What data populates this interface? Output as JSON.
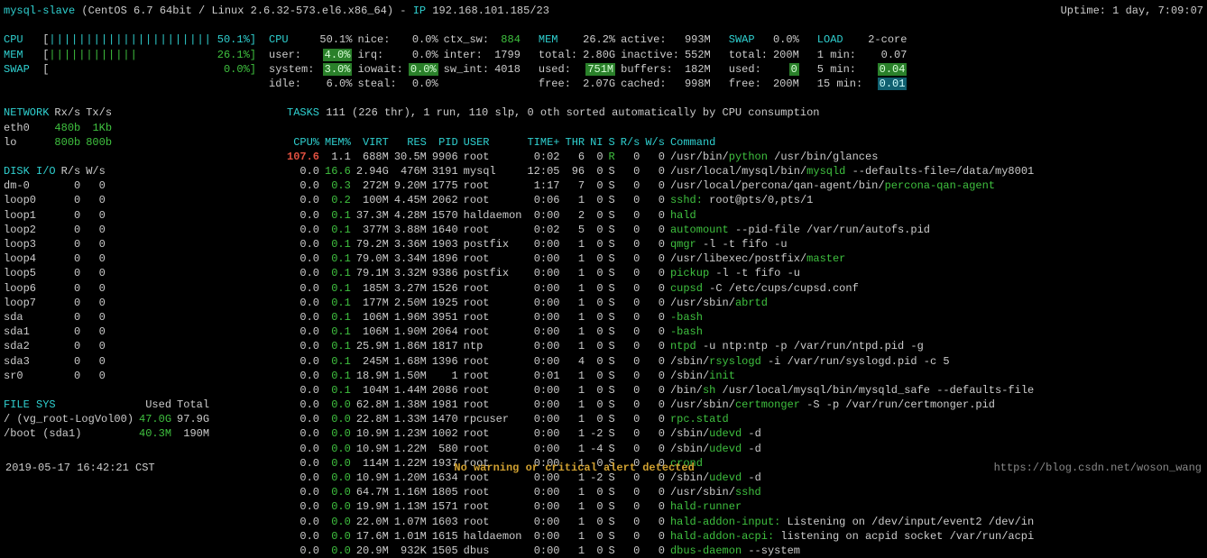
{
  "header": {
    "hostname": "mysql-slave",
    "os": "(CentOS 6.7 64bit / Linux 2.6.32-573.el6.x86_64)",
    "ip_label": "IP",
    "ip": "192.168.101.185/23",
    "uptime": "Uptime: 1 day, 7:09:07"
  },
  "bars": {
    "cpu_label": "CPU",
    "cpu_fill": "||||||||||||||||||||||",
    "cpu_val": "50.1%",
    "mem_label": "MEM",
    "mem_fill": "||||||||||||",
    "mem_val": "26.1%",
    "swap_label": "SWAP",
    "swap_fill": "",
    "swap_val": "0.0%"
  },
  "cpu_block": {
    "title": "CPU",
    "total": "50.1%",
    "user_l": "user:",
    "user_v": "4.0%",
    "system_l": "system:",
    "system_v": "3.0%",
    "idle_l": "idle:",
    "idle_v": "6.0%",
    "nice_l": "nice:",
    "nice_v": "0.0%",
    "irq_l": "irq:",
    "irq_v": "0.0%",
    "iowait_l": "iowait:",
    "iowait_v": "0.0%",
    "steal_l": "steal:",
    "steal_v": "0.0%",
    "ctx_l": "ctx_sw:",
    "ctx_v": "884",
    "inter_l": "inter:",
    "inter_v": "1799",
    "swint_l": "sw_int:",
    "swint_v": "4018"
  },
  "mem_block": {
    "title": "MEM",
    "total_pct": "26.2%",
    "total_l": "total:",
    "total_v": "2.80G",
    "used_l": "used:",
    "used_v": "751M",
    "free_l": "free:",
    "free_v": "2.07G",
    "active_l": "active:",
    "active_v": "993M",
    "inactive_l": "inactive:",
    "inactive_v": "552M",
    "buffers_l": "buffers:",
    "buffers_v": "182M",
    "cached_l": "cached:",
    "cached_v": "998M"
  },
  "swap_block": {
    "title": "SWAP",
    "pct": "0.0%",
    "total_l": "total:",
    "total_v": "200M",
    "used_l": "used:",
    "used_v": "0",
    "free_l": "free:",
    "free_v": "200M"
  },
  "load_block": {
    "title": "LOAD",
    "core": "2-core",
    "m1_l": "1 min:",
    "m1_v": "0.07",
    "m5_l": "5 min:",
    "m5_v": "0.04",
    "m15_l": "15 min:",
    "m15_v": "0.01"
  },
  "tasks_line": "TASKS 111 (226 thr), 1 run, 110 slp, 0 oth sorted automatically by CPU consumption",
  "network": {
    "title": "NETWORK",
    "hrx": "Rx/s",
    "htx": "Tx/s",
    "rows": [
      {
        "if": "eth0",
        "rx": "480b",
        "tx": "1Kb"
      },
      {
        "if": "lo",
        "rx": "800b",
        "tx": "800b"
      }
    ]
  },
  "disk": {
    "title": "DISK I/O",
    "hr": "R/s",
    "hw": "W/s",
    "rows": [
      {
        "d": "dm-0",
        "r": "0",
        "w": "0"
      },
      {
        "d": "loop0",
        "r": "0",
        "w": "0"
      },
      {
        "d": "loop1",
        "r": "0",
        "w": "0"
      },
      {
        "d": "loop2",
        "r": "0",
        "w": "0"
      },
      {
        "d": "loop3",
        "r": "0",
        "w": "0"
      },
      {
        "d": "loop4",
        "r": "0",
        "w": "0"
      },
      {
        "d": "loop5",
        "r": "0",
        "w": "0"
      },
      {
        "d": "loop6",
        "r": "0",
        "w": "0"
      },
      {
        "d": "loop7",
        "r": "0",
        "w": "0"
      },
      {
        "d": "sda",
        "r": "0",
        "w": "0"
      },
      {
        "d": "sda1",
        "r": "0",
        "w": "0"
      },
      {
        "d": "sda2",
        "r": "0",
        "w": "0"
      },
      {
        "d": "sda3",
        "r": "0",
        "w": "0"
      },
      {
        "d": "sr0",
        "r": "0",
        "w": "0"
      }
    ]
  },
  "fs": {
    "title": "FILE SYS",
    "hu": "Used",
    "ht": "Total",
    "rows": [
      {
        "d": "/ (vg_root-LogVol00)",
        "u": "47.0G",
        "t": "97.9G"
      },
      {
        "d": "/boot (sda1)",
        "u": "40.3M",
        "t": "190M"
      }
    ]
  },
  "proc_headers": [
    "CPU%",
    "MEM%",
    "VIRT",
    "RES",
    "PID",
    "USER",
    "TIME+",
    "THR",
    "NI",
    "S",
    "R/s",
    "W/s",
    "Command"
  ],
  "processes": [
    {
      "cpu": "107.6",
      "cpu_cls": "redb",
      "mem": "1.1",
      "virt": "688M",
      "res": "30.5M",
      "pid": "9906",
      "user": "root",
      "time": "0:02",
      "thr": "6",
      "ni": "0",
      "s": "R",
      "sc": "green",
      "rs": "0",
      "ws": "0",
      "cmd": [
        {
          "t": "/usr/bin/",
          "c": ""
        },
        {
          "t": "python",
          "c": "green"
        },
        {
          "t": " /usr/bin/glances",
          "c": ""
        }
      ]
    },
    {
      "cpu": "0.0",
      "mem": "16.6",
      "mem_cls": "green",
      "virt": "2.94G",
      "res": "476M",
      "pid": "3191",
      "user": "mysql",
      "time": "12:05",
      "thr": "96",
      "ni": "0",
      "s": "S",
      "rs": "0",
      "ws": "0",
      "cmd": [
        {
          "t": "/usr/local/mysql/bin/",
          "c": ""
        },
        {
          "t": "mysqld",
          "c": "green"
        },
        {
          "t": " --defaults-file=/data/my8001",
          "c": ""
        }
      ]
    },
    {
      "cpu": "0.0",
      "mem": "0.3",
      "mem_cls": "green",
      "virt": "272M",
      "res": "9.20M",
      "pid": "1775",
      "user": "root",
      "time": "1:17",
      "thr": "7",
      "ni": "0",
      "s": "S",
      "rs": "0",
      "ws": "0",
      "cmd": [
        {
          "t": "/usr/local/percona/qan-agent/bin/",
          "c": ""
        },
        {
          "t": "percona-qan-agent",
          "c": "green"
        }
      ]
    },
    {
      "cpu": "0.0",
      "mem": "0.2",
      "mem_cls": "green",
      "virt": "100M",
      "res": "4.45M",
      "pid": "2062",
      "user": "root",
      "time": "0:06",
      "thr": "1",
      "ni": "0",
      "s": "S",
      "rs": "0",
      "ws": "0",
      "cmd": [
        {
          "t": "sshd:",
          "c": "green"
        },
        {
          "t": " root@pts/0,pts/1",
          "c": ""
        }
      ]
    },
    {
      "cpu": "0.0",
      "mem": "0.1",
      "mem_cls": "green",
      "virt": "37.3M",
      "res": "4.28M",
      "pid": "1570",
      "user": "haldaemon",
      "time": "0:00",
      "thr": "2",
      "ni": "0",
      "s": "S",
      "rs": "0",
      "ws": "0",
      "cmd": [
        {
          "t": "hald",
          "c": "green"
        }
      ]
    },
    {
      "cpu": "0.0",
      "mem": "0.1",
      "mem_cls": "green",
      "virt": "377M",
      "res": "3.88M",
      "pid": "1640",
      "user": "root",
      "time": "0:02",
      "thr": "5",
      "ni": "0",
      "s": "S",
      "rs": "0",
      "ws": "0",
      "cmd": [
        {
          "t": "automount",
          "c": "green"
        },
        {
          "t": " --pid-file /var/run/autofs.pid",
          "c": ""
        }
      ]
    },
    {
      "cpu": "0.0",
      "mem": "0.1",
      "mem_cls": "green",
      "virt": "79.2M",
      "res": "3.36M",
      "pid": "1903",
      "user": "postfix",
      "time": "0:00",
      "thr": "1",
      "ni": "0",
      "s": "S",
      "rs": "0",
      "ws": "0",
      "cmd": [
        {
          "t": "qmgr",
          "c": "green"
        },
        {
          "t": " -l -t fifo -u",
          "c": ""
        }
      ]
    },
    {
      "cpu": "0.0",
      "mem": "0.1",
      "mem_cls": "green",
      "virt": "79.0M",
      "res": "3.34M",
      "pid": "1896",
      "user": "root",
      "time": "0:00",
      "thr": "1",
      "ni": "0",
      "s": "S",
      "rs": "0",
      "ws": "0",
      "cmd": [
        {
          "t": "/usr/libexec/postfix/",
          "c": ""
        },
        {
          "t": "master",
          "c": "green"
        }
      ]
    },
    {
      "cpu": "0.0",
      "mem": "0.1",
      "mem_cls": "green",
      "virt": "79.1M",
      "res": "3.32M",
      "pid": "9386",
      "user": "postfix",
      "time": "0:00",
      "thr": "1",
      "ni": "0",
      "s": "S",
      "rs": "0",
      "ws": "0",
      "cmd": [
        {
          "t": "pickup",
          "c": "green"
        },
        {
          "t": " -l -t fifo -u",
          "c": ""
        }
      ]
    },
    {
      "cpu": "0.0",
      "mem": "0.1",
      "mem_cls": "green",
      "virt": "185M",
      "res": "3.27M",
      "pid": "1526",
      "user": "root",
      "time": "0:00",
      "thr": "1",
      "ni": "0",
      "s": "S",
      "rs": "0",
      "ws": "0",
      "cmd": [
        {
          "t": "cupsd",
          "c": "green"
        },
        {
          "t": " -C /etc/cups/cupsd.conf",
          "c": ""
        }
      ]
    },
    {
      "cpu": "0.0",
      "mem": "0.1",
      "mem_cls": "green",
      "virt": "177M",
      "res": "2.50M",
      "pid": "1925",
      "user": "root",
      "time": "0:00",
      "thr": "1",
      "ni": "0",
      "s": "S",
      "rs": "0",
      "ws": "0",
      "cmd": [
        {
          "t": "/usr/sbin/",
          "c": ""
        },
        {
          "t": "abrtd",
          "c": "green"
        }
      ]
    },
    {
      "cpu": "0.0",
      "mem": "0.1",
      "mem_cls": "green",
      "virt": "106M",
      "res": "1.96M",
      "pid": "3951",
      "user": "root",
      "time": "0:00",
      "thr": "1",
      "ni": "0",
      "s": "S",
      "rs": "0",
      "ws": "0",
      "cmd": [
        {
          "t": "-bash",
          "c": "green"
        }
      ]
    },
    {
      "cpu": "0.0",
      "mem": "0.1",
      "mem_cls": "green",
      "virt": "106M",
      "res": "1.90M",
      "pid": "2064",
      "user": "root",
      "time": "0:00",
      "thr": "1",
      "ni": "0",
      "s": "S",
      "rs": "0",
      "ws": "0",
      "cmd": [
        {
          "t": "-bash",
          "c": "green"
        }
      ]
    },
    {
      "cpu": "0.0",
      "mem": "0.1",
      "mem_cls": "green",
      "virt": "25.9M",
      "res": "1.86M",
      "pid": "1817",
      "user": "ntp",
      "time": "0:00",
      "thr": "1",
      "ni": "0",
      "s": "S",
      "rs": "0",
      "ws": "0",
      "cmd": [
        {
          "t": "ntpd",
          "c": "green"
        },
        {
          "t": " -u ntp:ntp -p /var/run/ntpd.pid -g",
          "c": ""
        }
      ]
    },
    {
      "cpu": "0.0",
      "mem": "0.1",
      "mem_cls": "green",
      "virt": "245M",
      "res": "1.68M",
      "pid": "1396",
      "user": "root",
      "time": "0:00",
      "thr": "4",
      "ni": "0",
      "s": "S",
      "rs": "0",
      "ws": "0",
      "cmd": [
        {
          "t": "/sbin/",
          "c": ""
        },
        {
          "t": "rsyslogd",
          "c": "green"
        },
        {
          "t": " -i /var/run/syslogd.pid -c 5",
          "c": ""
        }
      ]
    },
    {
      "cpu": "0.0",
      "mem": "0.1",
      "mem_cls": "green",
      "virt": "18.9M",
      "res": "1.50M",
      "pid": "1",
      "user": "root",
      "time": "0:01",
      "thr": "1",
      "ni": "0",
      "s": "S",
      "rs": "0",
      "ws": "0",
      "cmd": [
        {
          "t": "/sbin/",
          "c": ""
        },
        {
          "t": "init",
          "c": "green"
        }
      ]
    },
    {
      "cpu": "0.0",
      "mem": "0.1",
      "mem_cls": "green",
      "virt": "104M",
      "res": "1.44M",
      "pid": "2086",
      "user": "root",
      "time": "0:00",
      "thr": "1",
      "ni": "0",
      "s": "S",
      "rs": "0",
      "ws": "0",
      "cmd": [
        {
          "t": "/bin/",
          "c": ""
        },
        {
          "t": "sh",
          "c": "green"
        },
        {
          "t": " /usr/local/mysql/bin/mysqld_safe --defaults-file",
          "c": ""
        }
      ]
    },
    {
      "cpu": "0.0",
      "mem": "0.0",
      "mem_cls": "green",
      "virt": "62.8M",
      "res": "1.38M",
      "pid": "1981",
      "user": "root",
      "time": "0:00",
      "thr": "1",
      "ni": "0",
      "s": "S",
      "rs": "0",
      "ws": "0",
      "cmd": [
        {
          "t": "/usr/sbin/",
          "c": ""
        },
        {
          "t": "certmonger",
          "c": "green"
        },
        {
          "t": " -S -p /var/run/certmonger.pid",
          "c": ""
        }
      ]
    },
    {
      "cpu": "0.0",
      "mem": "0.0",
      "mem_cls": "green",
      "virt": "22.8M",
      "res": "1.33M",
      "pid": "1470",
      "user": "rpcuser",
      "time": "0:00",
      "thr": "1",
      "ni": "0",
      "s": "S",
      "rs": "0",
      "ws": "0",
      "cmd": [
        {
          "t": "rpc.statd",
          "c": "green"
        }
      ]
    },
    {
      "cpu": "0.0",
      "mem": "0.0",
      "mem_cls": "green",
      "virt": "10.9M",
      "res": "1.23M",
      "pid": "1002",
      "user": "root",
      "time": "0:00",
      "thr": "1",
      "ni": "-2",
      "s": "S",
      "rs": "0",
      "ws": "0",
      "cmd": [
        {
          "t": "/sbin/",
          "c": ""
        },
        {
          "t": "udevd",
          "c": "green"
        },
        {
          "t": " -d",
          "c": ""
        }
      ]
    },
    {
      "cpu": "0.0",
      "mem": "0.0",
      "mem_cls": "green",
      "virt": "10.9M",
      "res": "1.22M",
      "pid": "580",
      "user": "root",
      "time": "0:00",
      "thr": "1",
      "ni": "-4",
      "s": "S",
      "rs": "0",
      "ws": "0",
      "cmd": [
        {
          "t": "/sbin/",
          "c": ""
        },
        {
          "t": "udevd",
          "c": "green"
        },
        {
          "t": " -d",
          "c": ""
        }
      ]
    },
    {
      "cpu": "0.0",
      "mem": "0.0",
      "mem_cls": "green",
      "virt": "114M",
      "res": "1.22M",
      "pid": "1937",
      "user": "root",
      "time": "0:00",
      "thr": "1",
      "ni": "0",
      "s": "S",
      "rs": "0",
      "ws": "0",
      "cmd": [
        {
          "t": "crond",
          "c": "green"
        }
      ]
    },
    {
      "cpu": "0.0",
      "mem": "0.0",
      "mem_cls": "green",
      "virt": "10.9M",
      "res": "1.20M",
      "pid": "1634",
      "user": "root",
      "time": "0:00",
      "thr": "1",
      "ni": "-2",
      "s": "S",
      "rs": "0",
      "ws": "0",
      "cmd": [
        {
          "t": "/sbin/",
          "c": ""
        },
        {
          "t": "udevd",
          "c": "green"
        },
        {
          "t": " -d",
          "c": ""
        }
      ]
    },
    {
      "cpu": "0.0",
      "mem": "0.0",
      "mem_cls": "green",
      "virt": "64.7M",
      "res": "1.16M",
      "pid": "1805",
      "user": "root",
      "time": "0:00",
      "thr": "1",
      "ni": "0",
      "s": "S",
      "rs": "0",
      "ws": "0",
      "cmd": [
        {
          "t": "/usr/sbin/",
          "c": ""
        },
        {
          "t": "sshd",
          "c": "green"
        }
      ]
    },
    {
      "cpu": "0.0",
      "mem": "0.0",
      "mem_cls": "green",
      "virt": "19.9M",
      "res": "1.13M",
      "pid": "1571",
      "user": "root",
      "time": "0:00",
      "thr": "1",
      "ni": "0",
      "s": "S",
      "rs": "0",
      "ws": "0",
      "cmd": [
        {
          "t": "hald-runner",
          "c": "green"
        }
      ]
    },
    {
      "cpu": "0.0",
      "mem": "0.0",
      "mem_cls": "green",
      "virt": "22.0M",
      "res": "1.07M",
      "pid": "1603",
      "user": "root",
      "time": "0:00",
      "thr": "1",
      "ni": "0",
      "s": "S",
      "rs": "0",
      "ws": "0",
      "cmd": [
        {
          "t": "hald-addon-input:",
          "c": "green"
        },
        {
          "t": " Listening on /dev/input/event2 /dev/in",
          "c": ""
        }
      ]
    },
    {
      "cpu": "0.0",
      "mem": "0.0",
      "mem_cls": "green",
      "virt": "17.6M",
      "res": "1.01M",
      "pid": "1615",
      "user": "haldaemon",
      "time": "0:00",
      "thr": "1",
      "ni": "0",
      "s": "S",
      "rs": "0",
      "ws": "0",
      "cmd": [
        {
          "t": "hald-addon-acpi:",
          "c": "green"
        },
        {
          "t": " listening on acpid socket /var/run/acpi",
          "c": ""
        }
      ]
    },
    {
      "cpu": "0.0",
      "mem": "0.0",
      "mem_cls": "green",
      "virt": "20.9M",
      "res": "932K",
      "pid": "1505",
      "user": "dbus",
      "time": "0:00",
      "thr": "1",
      "ni": "0",
      "s": "S",
      "rs": "0",
      "ws": "0",
      "cmd": [
        {
          "t": "dbus-daemon",
          "c": "green"
        },
        {
          "t": " --system",
          "c": ""
        }
      ]
    }
  ],
  "footer": {
    "time": "2019-05-17 16:42:21 CST",
    "msg": "No warning or critical alert detected",
    "url": "https://blog.csdn.net/woson_wang"
  }
}
